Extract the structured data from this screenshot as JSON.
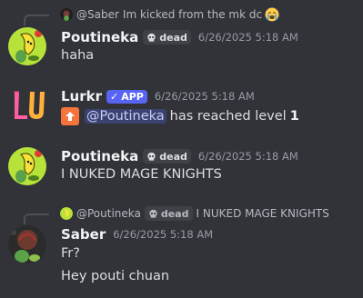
{
  "messages": [
    {
      "reply": {
        "user": "@Saber",
        "text": "Im kicked from the mk dc",
        "emoji": "crying-face-icon"
      },
      "user": "Poutineka",
      "tag": "dead",
      "timestamp": "6/26/2025 5:18 AM",
      "text": "haha"
    },
    {
      "user": "Lurkr",
      "badge": "APP",
      "timestamp": "6/26/2025 5:18 AM",
      "level_message": {
        "mention": "@Poutineka",
        "text": "has reached level",
        "level": "1"
      }
    },
    {
      "user": "Poutineka",
      "tag": "dead",
      "timestamp": "6/26/2025 5:18 AM",
      "text": "I NUKED MAGE KNIGHTS"
    },
    {
      "reply": {
        "user": "@Poutineka",
        "tag": "dead",
        "text": "I NUKED MAGE KNIGHTS"
      },
      "user": "Saber",
      "timestamp": "6/26/2025 5:18 AM",
      "text": "Fr?",
      "text2": "Hey pouti chuan"
    }
  ],
  "colors": {
    "background": "#323339",
    "app_badge": "#5865f2",
    "mention_bg": "#3c4270",
    "level_arrow": "#f4743b"
  }
}
